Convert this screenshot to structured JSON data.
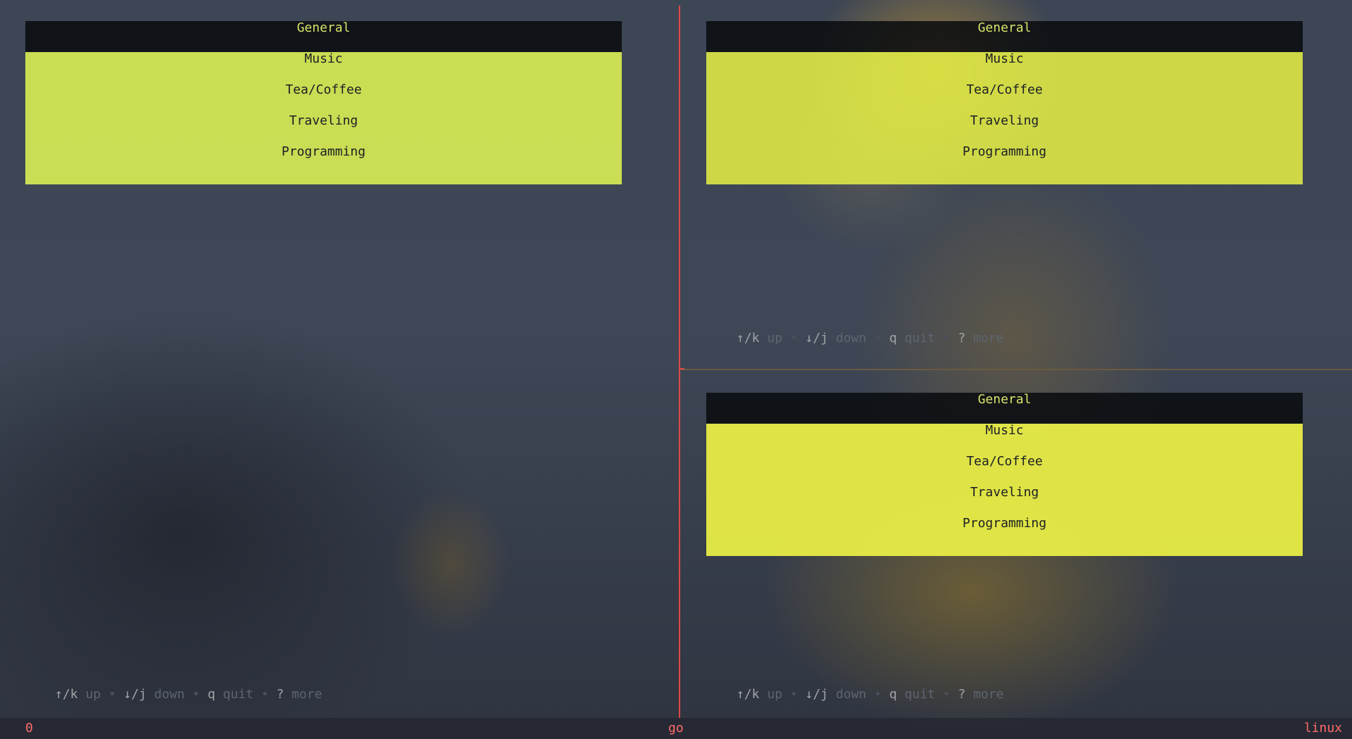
{
  "panes": [
    {
      "selected": "General",
      "items": [
        "Music",
        "Tea/Coffee",
        "Traveling",
        "Programming"
      ]
    },
    {
      "selected": "General",
      "items": [
        "Music",
        "Tea/Coffee",
        "Traveling",
        "Programming"
      ]
    },
    {
      "selected": "General",
      "items": [
        "Music",
        "Tea/Coffee",
        "Traveling",
        "Programming"
      ]
    }
  ],
  "help": {
    "up_key": "↑/k",
    "up_desc": "up",
    "down_key": "↓/j",
    "down_desc": "down",
    "quit_key": "q",
    "quit_desc": "quit",
    "more_key": "?",
    "more_desc": "more",
    "separator": "•"
  },
  "statusbar": {
    "left": "0",
    "center": "go",
    "right": "linux"
  },
  "colors": {
    "selected_bg": "#0a0c10",
    "selected_text": "#d8e368",
    "item_bg": "#d6ea54",
    "split_line": "#e04848",
    "status_text": "#ff6b6b"
  }
}
